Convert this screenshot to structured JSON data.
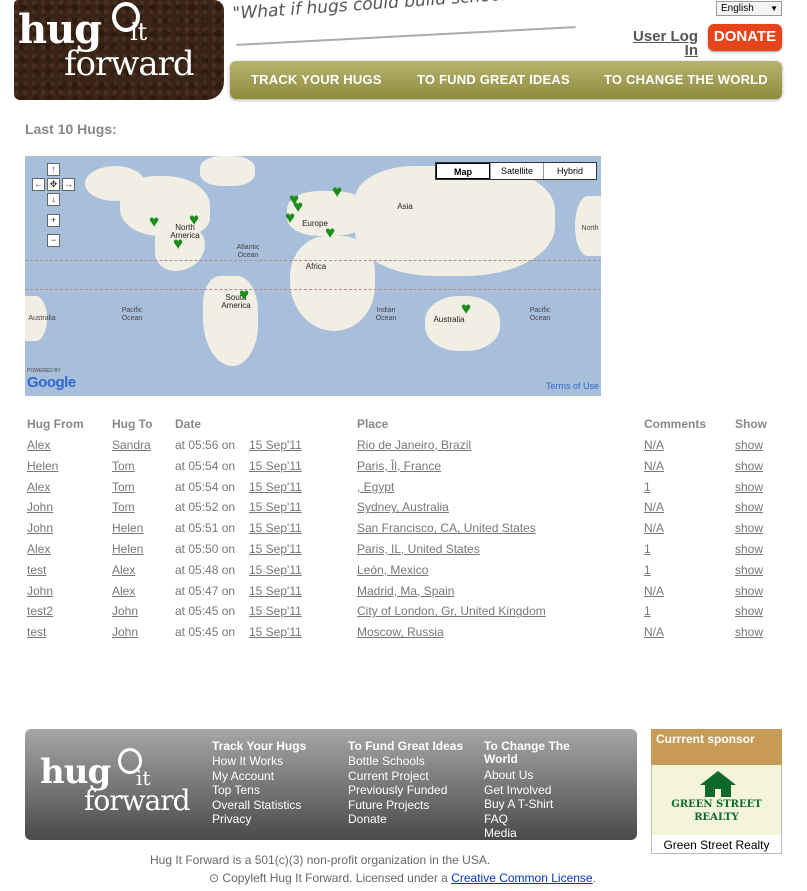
{
  "header": {
    "logo_hug": "hug",
    "logo_it": "it",
    "logo_forward": "forward",
    "tagline": "\"What if hugs could build schools?\"",
    "language": "English",
    "login": "User Log In",
    "donate": "DONATE"
  },
  "nav": {
    "items": [
      "TRACK YOUR HUGS",
      "TO FUND GREAT IDEAS",
      "TO CHANGE THE WORLD"
    ]
  },
  "section_title": "Last 10 Hugs:",
  "map": {
    "type_buttons": [
      "Map",
      "Satellite",
      "Hybrid"
    ],
    "labels": {
      "north_america": "North America",
      "south_america": "South America",
      "europe": "Europe",
      "asia": "Asia",
      "africa": "Africa",
      "australia_left": "Australia",
      "australia": "Australia",
      "north_right": "North",
      "atlantic": "Atlantic Ocean",
      "pacific_left": "Pacific Ocean",
      "pacific_right": "Pacific Ocean",
      "indian": "Indian Ocean"
    },
    "powered_by": "POWERED BY",
    "google": "Google",
    "terms": "Terms of Use",
    "marker_icon": "heart-icon"
  },
  "table": {
    "headers": [
      "Hug From",
      "Hug To",
      "Date",
      "Place",
      "Comments",
      "Show"
    ],
    "rows": [
      {
        "from": "Alex",
        "to": "Sandra",
        "time": "at 05:56 on",
        "date": "15 Sep'11",
        "place": "Rio de Janeiro, Brazil",
        "comments": "N/A",
        "show": "show"
      },
      {
        "from": "Helen",
        "to": "Tom",
        "time": "at 05:54 on",
        "date": "15 Sep'11",
        "place": "Paris, Îl, France",
        "comments": "N/A",
        "show": "show"
      },
      {
        "from": "Alex",
        "to": "Tom",
        "time": "at 05:54 on",
        "date": "15 Sep'11",
        "place": ", Egypt",
        "comments": "1",
        "show": "show"
      },
      {
        "from": "John",
        "to": "Tom",
        "time": "at 05:52 on",
        "date": "15 Sep'11",
        "place": "Sydney, Australia",
        "comments": "N/A",
        "show": "show"
      },
      {
        "from": "John",
        "to": "Helen",
        "time": "at 05:51 on",
        "date": "15 Sep'11",
        "place": "San Francisco, CA, United States",
        "comments": "N/A",
        "show": "show"
      },
      {
        "from": "Alex",
        "to": "Helen",
        "time": "at 05:50 on",
        "date": "15 Sep'11",
        "place": "Paris, IL, United States",
        "comments": "1",
        "show": "show"
      },
      {
        "from": "test",
        "to": "Alex",
        "time": "at 05:48 on",
        "date": "15 Sep'11",
        "place": "León, Mexico",
        "comments": "1",
        "show": "show"
      },
      {
        "from": "John",
        "to": "Alex",
        "time": "at 05:47 on",
        "date": "15 Sep'11",
        "place": "Madrid, Ma, Spain",
        "comments": "N/A",
        "show": "show"
      },
      {
        "from": "test2",
        "to": "John",
        "time": "at 05:45 on",
        "date": "15 Sep'11",
        "place": "City of London, Gr, United Kingdom",
        "comments": "1",
        "show": "show"
      },
      {
        "from": "test",
        "to": "John",
        "time": "at 05:45 on",
        "date": "15 Sep'11",
        "place": "Moscow, Russia",
        "comments": "N/A",
        "show": "show"
      }
    ]
  },
  "footer": {
    "columns": [
      {
        "heading": "Track Your Hugs",
        "items": [
          "How It Works",
          "My Account",
          "Top Tens",
          "Overall Statistics",
          "Privacy"
        ]
      },
      {
        "heading": "To Fund Great Ideas",
        "items": [
          "Bottle Schools",
          "Current Project",
          "Previously Funded",
          "Future Projects",
          "Donate"
        ]
      },
      {
        "heading": "To Change The World",
        "items": [
          "About Us",
          "Get Involved",
          "Buy A T-Shirt",
          "FAQ",
          "Media"
        ]
      }
    ],
    "sponsor_heading": "Currrent sponsor",
    "sponsor_logo_line1": "GREEN STREET",
    "sponsor_logo_line2": "REALTY",
    "sponsor_caption": "Green Street Realty",
    "npo": "Hug It Forward is a 501(c)(3) non-profit organization in the USA.",
    "copyleft": "Copyleft Hug It Forward. Licensed under a",
    "license": "Creative Common License",
    "period": "."
  }
}
